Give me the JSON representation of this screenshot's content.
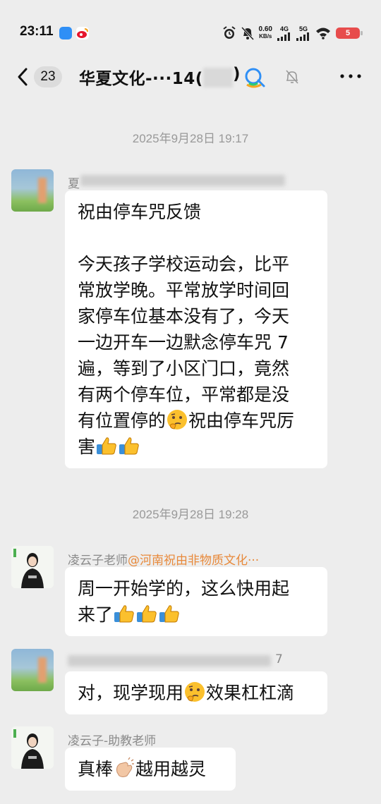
{
  "status_bar": {
    "time": "23:11",
    "net_speed": "0.60",
    "net_unit": "KB/s",
    "sig1": "4G",
    "sig2": "5G",
    "battery": "5"
  },
  "nav": {
    "unread_count": "23",
    "title": "华夏文化-···14(",
    "title_close": ")"
  },
  "messages": [
    {
      "timestamp": "2025年9月28日 19:17",
      "sender": "夏",
      "title": "祝由停车咒反馈",
      "body": [
        "今天孩子学校运动会，比平",
        "常放学晚。平常放学时间回",
        "家停车位基本没有了，今天",
        "一边开车一边默念停车咒 7",
        "遍，等到了小区门口，竟然",
        "有两个停车位，平常都是没",
        "有位置停的"
      ],
      "body_tail": "祝由停车咒厉",
      "body_last": "害"
    },
    {
      "timestamp": "2025年9月28日 19:28",
      "sender": "凌云子老师",
      "mention": "@河南祝由非物质文化···",
      "line1": "周一开始学的，这么快用起",
      "line2": "来了"
    },
    {
      "sender_suffix": "7",
      "text_a": "对，现学现用",
      "text_b": "效果杠杠滴"
    },
    {
      "sender": "凌云子-助教老师",
      "text_a": "真棒",
      "text_b": "越用越灵"
    }
  ],
  "icons": {
    "back": "chevron-left-icon",
    "group_type": "qq-group-icon",
    "mute": "bell-off-icon",
    "more": "more-dots-icon",
    "thumbs_up": "thumbs-up-emoji",
    "thinking": "thinking-face-emoji",
    "clap": "clapping-hands-emoji"
  },
  "colors": {
    "background": "#ededed",
    "bubble": "#ffffff",
    "mention": "#e8893a",
    "meta_text": "#999999",
    "battery": "#e74c4c"
  }
}
